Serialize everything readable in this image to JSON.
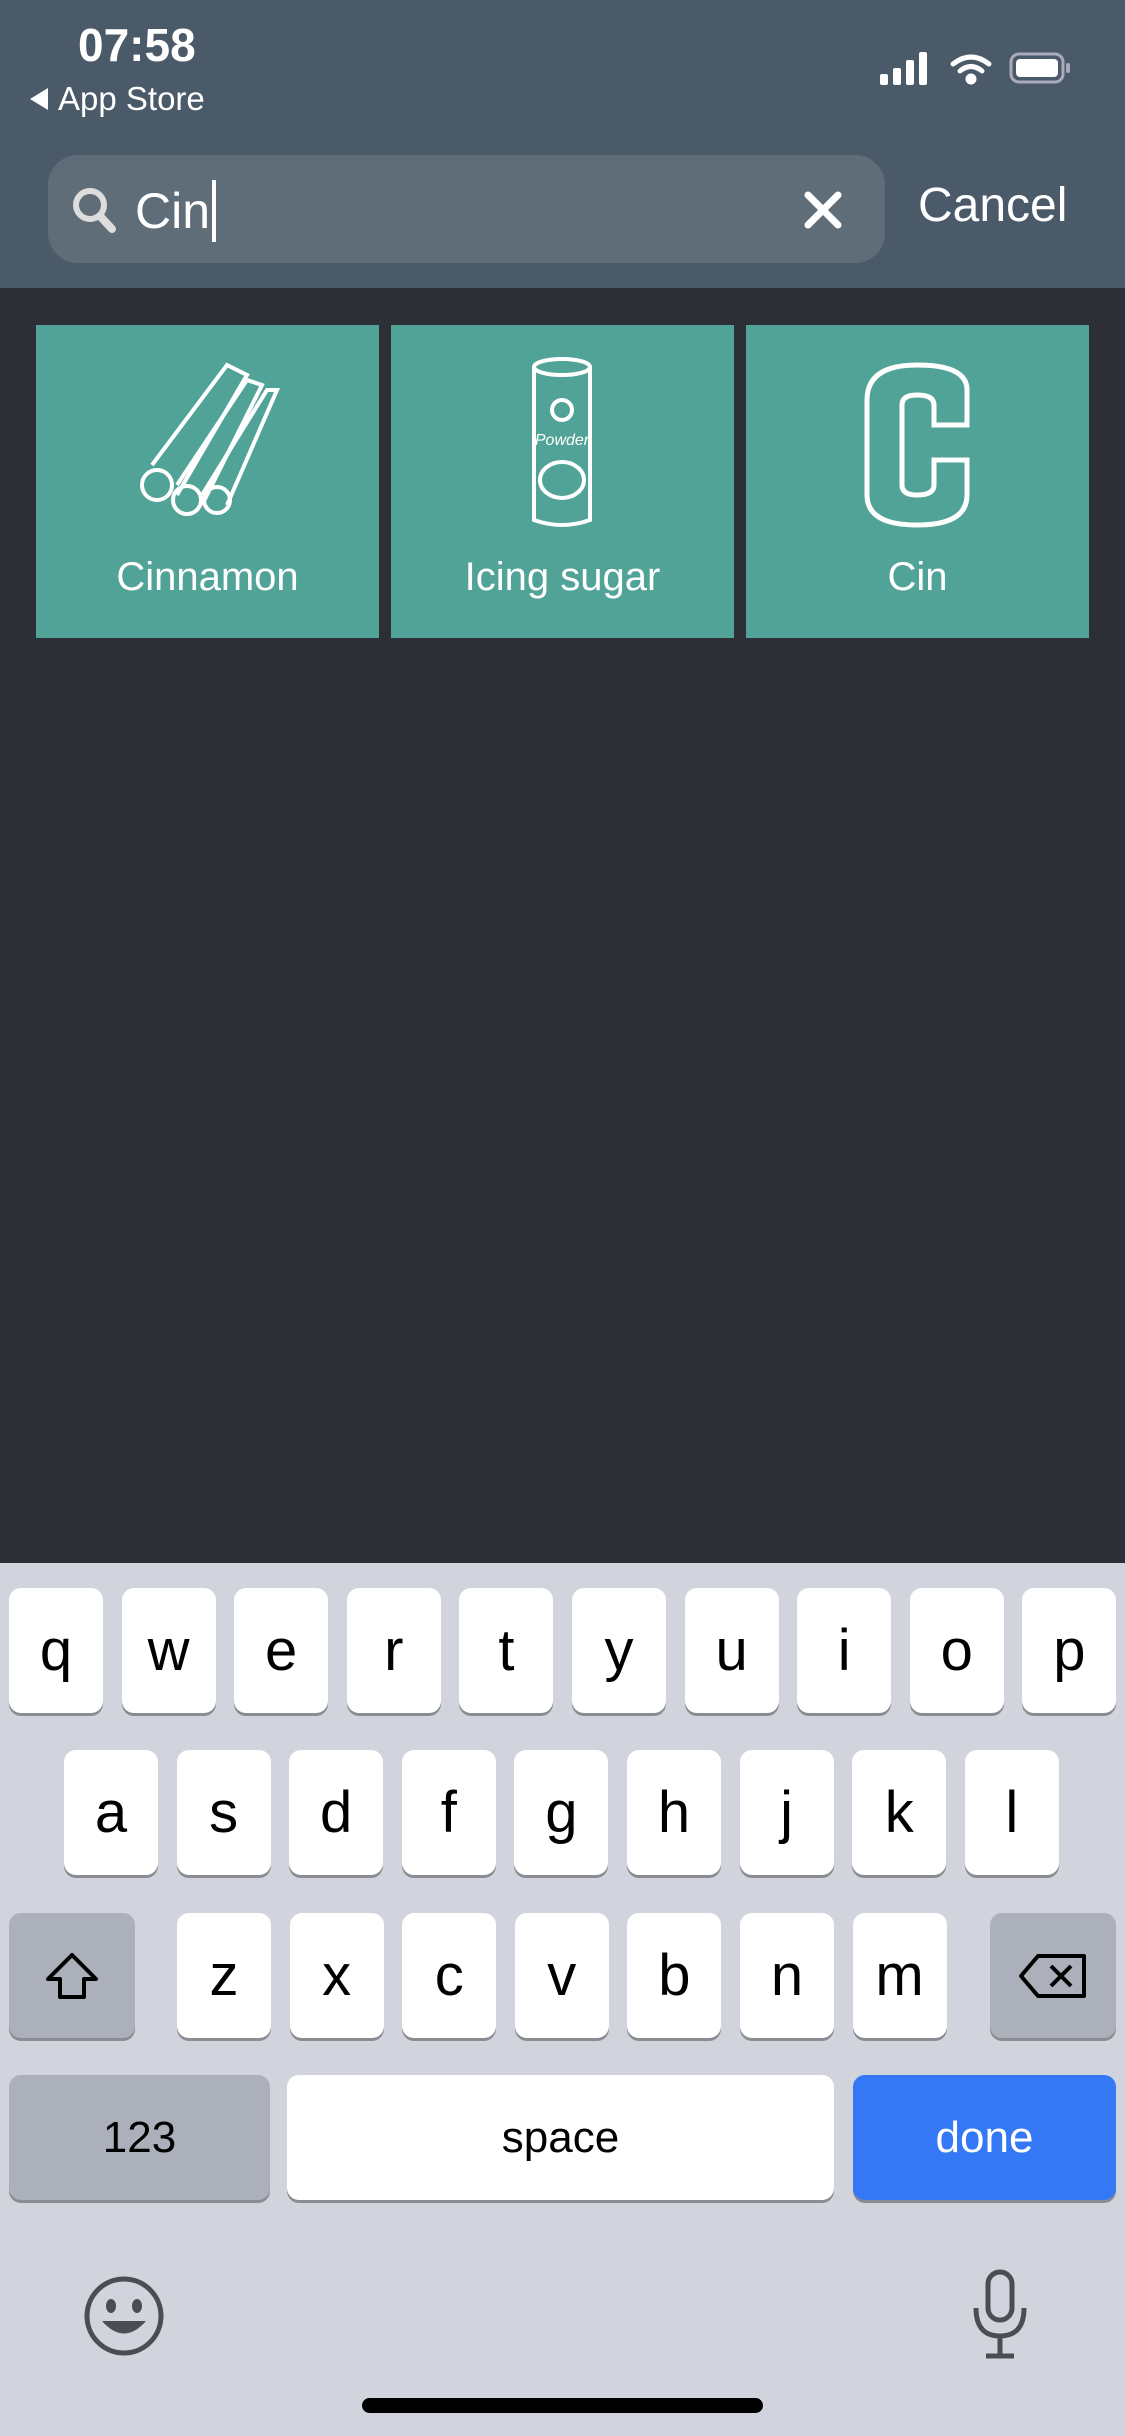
{
  "status_bar": {
    "time": "07:58",
    "back_label": "App Store"
  },
  "search": {
    "value": "Cin",
    "cancel_label": "Cancel"
  },
  "results": [
    {
      "label": "Cinnamon",
      "icon": "cinnamon-sticks-icon"
    },
    {
      "label": "Icing sugar",
      "icon": "powder-shaker-icon",
      "icon_text": "Powder"
    },
    {
      "label": "Cin",
      "icon": "letter-c-icon"
    }
  ],
  "keyboard": {
    "row1": [
      "q",
      "w",
      "e",
      "r",
      "t",
      "y",
      "u",
      "i",
      "o",
      "p"
    ],
    "row2": [
      "a",
      "s",
      "d",
      "f",
      "g",
      "h",
      "j",
      "k",
      "l"
    ],
    "row3": [
      "z",
      "x",
      "c",
      "v",
      "b",
      "n",
      "m"
    ],
    "numbers_label": "123",
    "space_label": "space",
    "done_label": "done"
  },
  "colors": {
    "header": "#4a5a69",
    "tile": "#52a397",
    "background": "#2c2f35",
    "done": "#3478f6"
  }
}
